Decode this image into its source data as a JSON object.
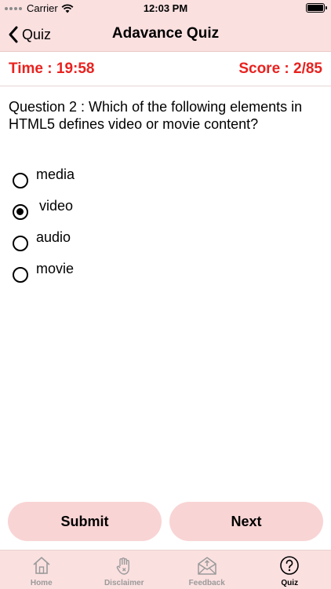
{
  "status_bar": {
    "carrier": "Carrier",
    "time": "12:03 PM"
  },
  "nav": {
    "back_label": "Quiz",
    "title": "Adavance Quiz"
  },
  "quiz": {
    "time_text": "Time : 19:58",
    "score_text": "Score : 2/85",
    "question": "Question 2 : Which of the following elements in HTML5 defines video or movie content?",
    "options": [
      {
        "label": "media",
        "selected": false
      },
      {
        "label": "video",
        "selected": true
      },
      {
        "label": "audio",
        "selected": false
      },
      {
        "label": "movie",
        "selected": false
      }
    ]
  },
  "buttons": {
    "submit_label": "Submit",
    "next_label": "Next"
  },
  "tabs": [
    {
      "label": "Home",
      "icon": "home-icon",
      "active": false
    },
    {
      "label": "Disclaimer",
      "icon": "hand-icon",
      "active": false
    },
    {
      "label": "Feedback",
      "icon": "envelope-icon",
      "active": false
    },
    {
      "label": "Quiz",
      "icon": "question-icon",
      "active": true
    }
  ],
  "colors": {
    "accent_red": "#e8221f",
    "bar_pink": "#fbe0e0",
    "button_pink": "#f9d4d4"
  }
}
